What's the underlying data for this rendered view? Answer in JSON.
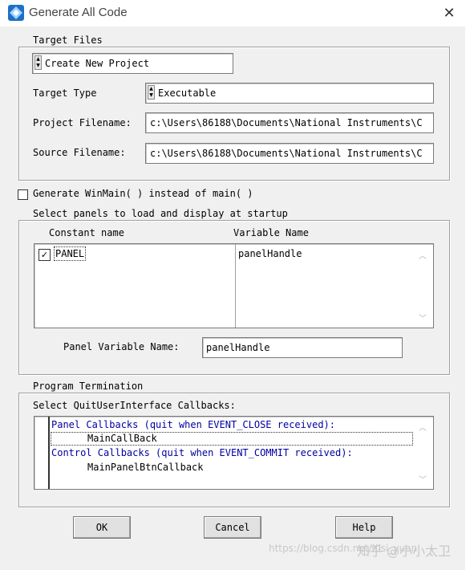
{
  "window": {
    "title": "Generate All Code",
    "close_glyph": "✕",
    "app_icon": "labwindows-diamond-icon"
  },
  "target_files": {
    "group_label": "Target Files",
    "project_mode": "Create New Project",
    "target_type_label": "Target Type",
    "target_type_value": "Executable",
    "project_filename_label": "Project Filename:",
    "project_filename_value": "c:\\Users\\86188\\Documents\\National Instruments\\C",
    "source_filename_label": "Source Filename:",
    "source_filename_value": "c:\\Users\\86188\\Documents\\National Instruments\\C"
  },
  "winmain": {
    "label": "Generate WinMain( ) instead of main( )",
    "checked": false
  },
  "panels": {
    "group_label": "Select panels to load and display at startup",
    "col_constant": "Constant name",
    "col_variable": "Variable Name",
    "rows": [
      {
        "constant": "PANEL",
        "variable": "panelHandle",
        "checked": true
      }
    ],
    "panel_var_label": "Panel Variable Name:",
    "panel_var_value": "panelHandle"
  },
  "termination": {
    "group_label": "Program Termination",
    "select_label": "Select QuitUserInterface Callbacks:",
    "items": [
      {
        "text": "Panel Callbacks (quit when EVENT_CLOSE received):",
        "kind": "header"
      },
      {
        "text": "MainCallBack",
        "kind": "item",
        "focused": true
      },
      {
        "text": "Control Callbacks (quit when EVENT_COMMIT received):",
        "kind": "header"
      },
      {
        "text": "MainPanelBtnCallback",
        "kind": "item",
        "focused": false
      }
    ]
  },
  "buttons": {
    "ok": "OK",
    "cancel": "Cancel",
    "help": "Help"
  },
  "watermark": {
    "url": "https://blog.csdn.net/Xisi_yuan",
    "cn": "知乎 @小小太卫"
  },
  "colors": {
    "callback_header": "#0000a0",
    "dialog_bg": "#f0f0f0"
  }
}
